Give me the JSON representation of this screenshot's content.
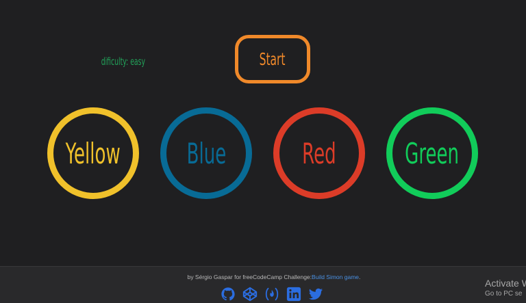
{
  "game": {
    "difficulty_label": "dificulty: easy",
    "start_label": "Start",
    "pads": [
      {
        "label": "Yellow",
        "color": "#f0c12b"
      },
      {
        "label": "Blue",
        "color": "#086b96"
      },
      {
        "label": "Red",
        "color": "#dc3c28"
      },
      {
        "label": "Green",
        "color": "#11cc5a"
      }
    ],
    "accent_color": "#f0892a",
    "difficulty_color": "#22a35a"
  },
  "footer": {
    "credit_prefix": "by Sérgio Gaspar for freeCodeCamp Challenge:",
    "credit_link": "Build Simon game",
    "credit_suffix": ".",
    "social_icons": [
      "github-icon",
      "codepen-icon",
      "freecodecamp-icon",
      "linkedin-icon",
      "twitter-icon"
    ],
    "icon_color": "#2b6de0"
  },
  "os_overlay": {
    "activate_title": "Activate W",
    "activate_sub": "Go to PC se"
  }
}
